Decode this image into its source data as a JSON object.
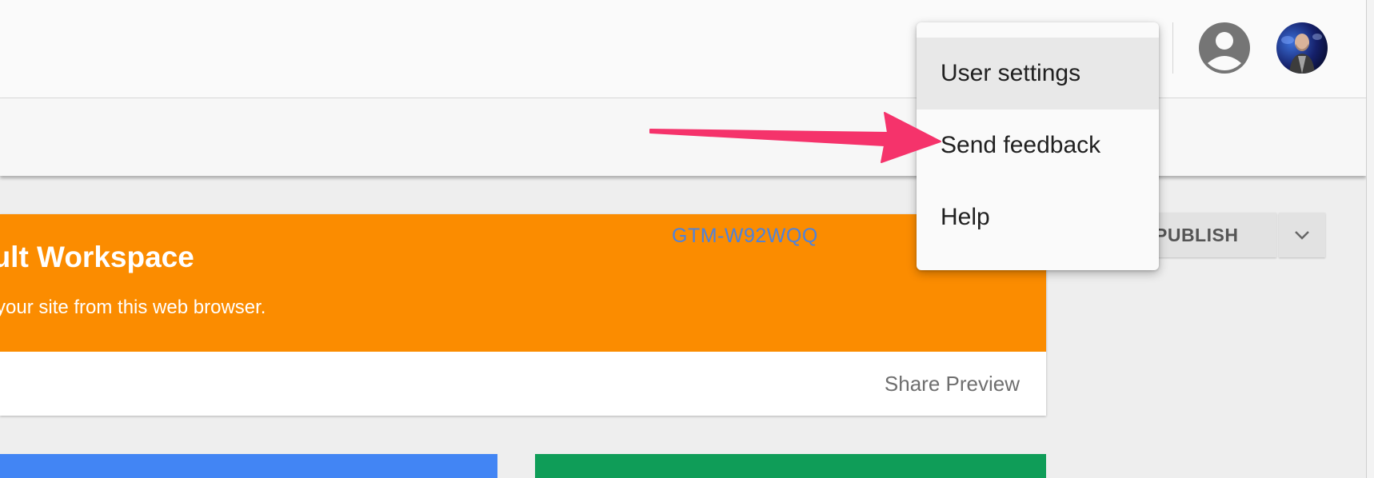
{
  "header": {
    "container_id": "GTM-W92WQQ",
    "publish_label": "PUBLISH"
  },
  "menu": {
    "items": [
      {
        "label": "User settings"
      },
      {
        "label": "Send feedback"
      },
      {
        "label": "Help"
      }
    ]
  },
  "workspace": {
    "title": "ault Workspace",
    "subtitle": "your site from this web browser.",
    "share_label": "Share Preview"
  },
  "colors": {
    "workspace_header": "#fb8c00",
    "container_link": "#4d82dd",
    "annotation_arrow": "#f5336b",
    "tile_blue": "#4285f4",
    "tile_green": "#0f9d58"
  },
  "icons": {
    "account": "account-circle-icon",
    "publish_menu": "chevron-down-icon"
  }
}
